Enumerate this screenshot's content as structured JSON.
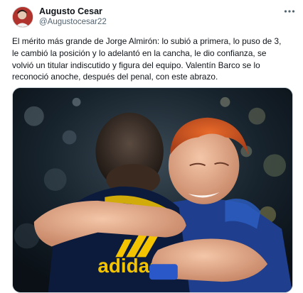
{
  "tweet": {
    "author": {
      "name": "Augusto Cesar",
      "handle": "@Augustocesar22"
    },
    "text_lines": [
      "El mérito más grande de Jorge Almirón: lo subió a primera, lo puso de 3,",
      "le cambió la posición y lo adelantó en la cancha, le dio confianza, se",
      "volvió un titular indiscutido y figura del equipo. Valentín Barco se lo",
      "reconoció anoche, después del penal, con este abrazo."
    ],
    "more_icon": "more-horizontal-icon",
    "media": {
      "jersey_brand": "adidas"
    }
  },
  "colors": {
    "text": "#0f1419",
    "secondary": "#536471",
    "jersey_navy": "#0c1b3c",
    "jersey_gold": "#f5c400",
    "jersey_blue": "#1f4ba8"
  }
}
